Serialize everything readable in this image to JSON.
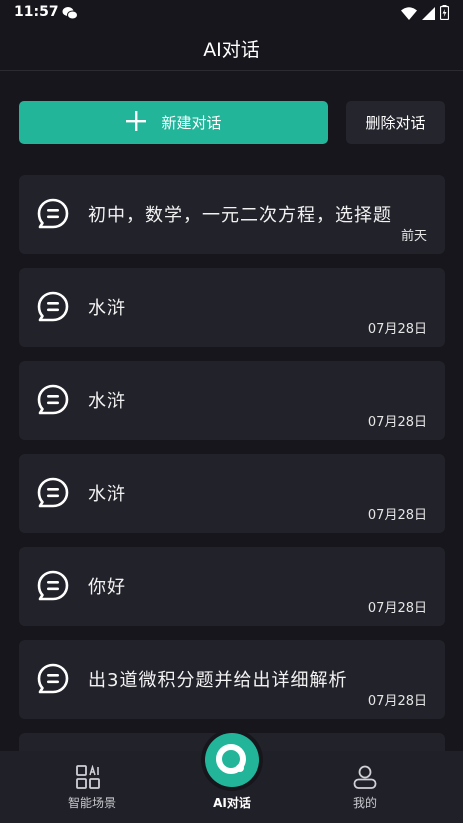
{
  "status_bar": {
    "time": "11:57"
  },
  "header": {
    "title": "AI对话"
  },
  "actions": {
    "new_chat_label": "新建对话",
    "delete_chat_label": "删除对话"
  },
  "conversations": [
    {
      "title": "初中，数学，一元二次方程，选择题",
      "date": "前天"
    },
    {
      "title": "水浒",
      "date": "07月28日"
    },
    {
      "title": "水浒",
      "date": "07月28日"
    },
    {
      "title": "水浒",
      "date": "07月28日"
    },
    {
      "title": "你好",
      "date": "07月28日"
    },
    {
      "title": "出3道微积分题并给出详细解析",
      "date": "07月28日"
    }
  ],
  "bottom_nav": {
    "items": [
      {
        "label": "智能场景",
        "icon": "grid-ai-icon"
      },
      {
        "label": "AI对话",
        "icon": "ai-chat-icon"
      },
      {
        "label": "我的",
        "icon": "user-icon"
      }
    ],
    "active_index": 1
  },
  "colors": {
    "accent": "#22b59a",
    "background": "#16161c",
    "card": "#22222a"
  }
}
